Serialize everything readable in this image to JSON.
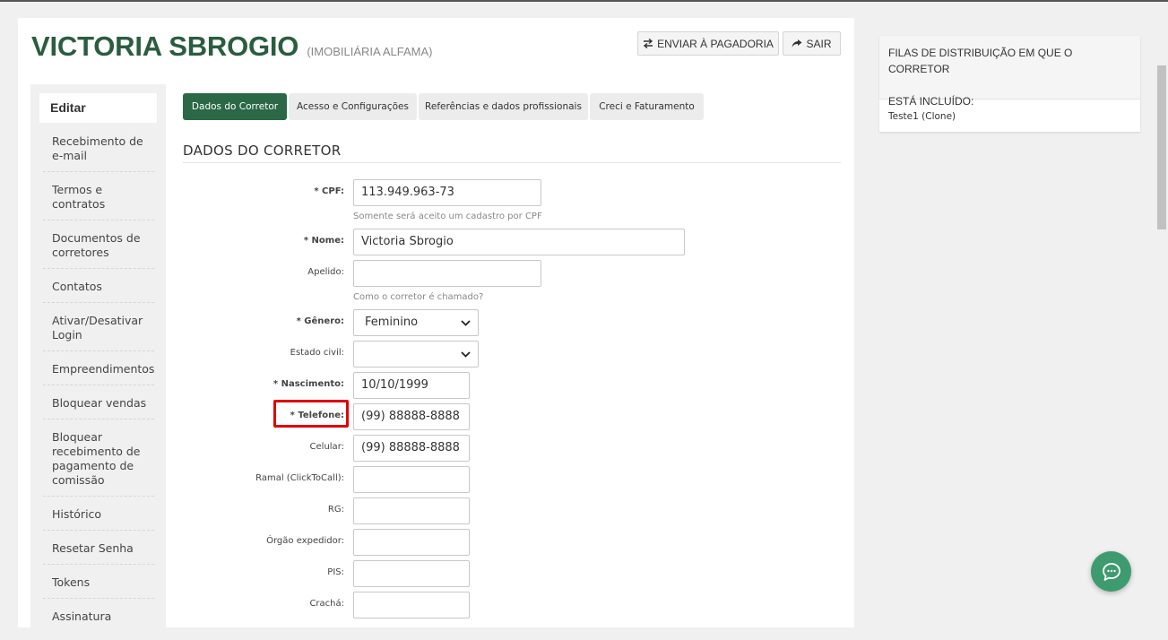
{
  "header": {
    "title": "VICTORIA SBROGIO",
    "subtitle": "(IMOBILIÁRIA ALFAMA)",
    "send_button": "ENVIAR À PAGADORIA",
    "exit_button": "SAIR"
  },
  "sidebar": {
    "heading": "Editar",
    "items": [
      "Recebimento de e-mail",
      "Termos e contratos",
      "Documentos de corretores",
      "Contatos",
      "Ativar/Desativar Login",
      "Empreendimentos",
      "Bloquear vendas",
      "Bloquear recebimento de pagamento de comissão",
      "Histórico",
      "Resetar Senha",
      "Tokens",
      "Assinatura"
    ]
  },
  "tabs": [
    {
      "label": "Dados do Corretor",
      "active": true
    },
    {
      "label": "Acesso e Configurações",
      "active": false
    },
    {
      "label": "Referências e dados profissionais",
      "active": false
    },
    {
      "label": "Creci e Faturamento",
      "active": false
    }
  ],
  "section_title": "DADOS DO CORRETOR",
  "form": {
    "cpf": {
      "label": "* CPF:",
      "value": "113.949.963-73",
      "hint": "Somente será aceito um cadastro por CPF"
    },
    "nome": {
      "label": "* Nome:",
      "value": "Victoria Sbrogio"
    },
    "apelido": {
      "label": "Apelido:",
      "value": "",
      "hint": "Como o corretor é chamado?"
    },
    "genero": {
      "label": "* Gênero:",
      "value": "Feminino"
    },
    "estado_civil": {
      "label": "Estado civil:",
      "value": ""
    },
    "nascimento": {
      "label": "* Nascimento:",
      "value": "10/10/1999"
    },
    "telefone": {
      "label": "* Telefone:",
      "value": "(99) 88888-8888"
    },
    "celular": {
      "label": "Celular:",
      "value": "(99) 88888-8888"
    },
    "ramal": {
      "label": "Ramal (ClickToCall):",
      "value": ""
    },
    "rg": {
      "label": "RG:",
      "value": ""
    },
    "orgao": {
      "label": "Órgão expedidor:",
      "value": ""
    },
    "pis": {
      "label": "PIS:",
      "value": ""
    },
    "cracha": {
      "label": "Crachá:",
      "value": ""
    }
  },
  "right_panel": {
    "title_line1": "FILAS DE DISTRIBUIÇÃO EM QUE O CORRETOR",
    "title_line2": "ESTÁ INCLUÍDO:",
    "items": [
      "Teste1 (Clone)"
    ]
  },
  "colors": {
    "brand_green": "#2a5d3f",
    "active_tab": "#2b6846",
    "highlight": "#e00000",
    "chat": "#3e9b6f"
  },
  "icons": {
    "send": "swap-arrows-icon",
    "exit": "share-arrow-icon",
    "chat": "chat-bubble-icon",
    "select": "chevron-down-icon"
  }
}
